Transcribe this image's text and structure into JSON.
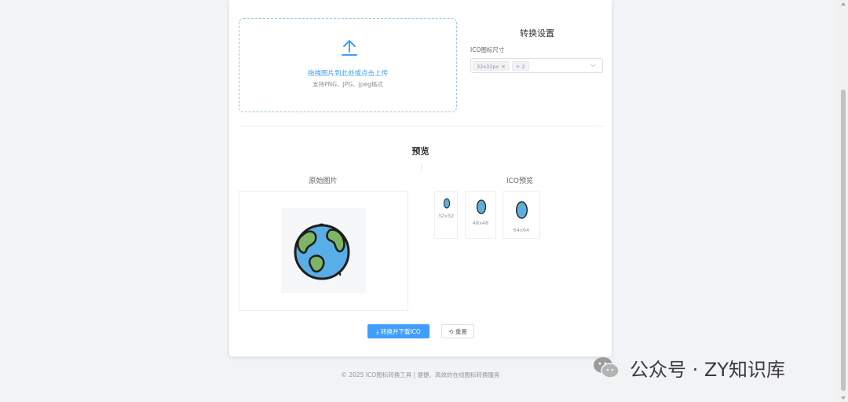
{
  "upload": {
    "main_text": "拖拽图片到此处或点击上传",
    "sub_text": "支持PNG、JPG、jpeg格式"
  },
  "settings": {
    "title": "转换设置",
    "size_label": "ICO图标尺寸",
    "selected_tag": "32x32px",
    "more_tag": "+ 2"
  },
  "preview": {
    "title": "预览",
    "original_label": "原始图片",
    "ico_label": "ICO预览",
    "sizes": [
      "32x32",
      "48x48",
      "64x64"
    ]
  },
  "actions": {
    "convert_label": "⤓ 转换并下载ICO",
    "reset_label": "⟲ 重置"
  },
  "footer": {
    "text": "© 2025 ICO图标转换工具 | 便捷、高效的在线图标转换服务"
  },
  "watermark": {
    "text": "公众号 · ZY知识库"
  },
  "colors": {
    "accent": "#409eff",
    "ocean": "#5aaee8",
    "land": "#7db465"
  }
}
